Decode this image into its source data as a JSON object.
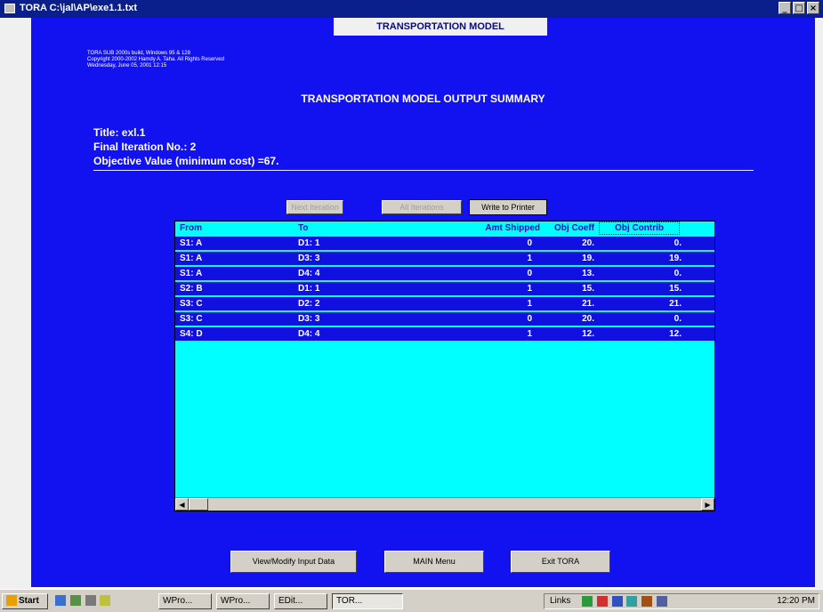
{
  "window": {
    "title": "TORA C:\\jal\\AP\\exe1.1.txt",
    "minimize_glyph": "_",
    "maximize_glyph": "□",
    "close_glyph": "×"
  },
  "panel": {
    "header": "TRANSPORTATION MODEL",
    "copyright": [
      "TORA SUB 2000s build, Windows 95 & 128",
      "Copyright 2000-2002 Hamdy A. Taha. All Rights Reserved",
      "Wednesday, June 05, 2001 12:15"
    ],
    "summary_title": "TRANSPORTATION MODEL OUTPUT SUMMARY",
    "title_line": "Title: exl.1",
    "iteration_line": "Final Iteration No.: 2",
    "objective_line": "Objective Value (minimum cost) =67."
  },
  "actions": {
    "next_iteration": "Next Iteration",
    "all_iterations": "All Iterations",
    "write_to_printer": "Write to Printer"
  },
  "table": {
    "columns": [
      "From",
      "To",
      "Amt Shipped",
      "Obj Coeff",
      "Obj Contrib"
    ],
    "rows": [
      [
        "S1: A",
        "D1: 1",
        "0",
        "20.",
        "0."
      ],
      [
        "S1: A",
        "D3: 3",
        "1",
        "19.",
        "19."
      ],
      [
        "S1: A",
        "D4: 4",
        "0",
        "13.",
        "0."
      ],
      [
        "S2: B",
        "D1: 1",
        "1",
        "15.",
        "15."
      ],
      [
        "S3: C",
        "D2: 2",
        "1",
        "21.",
        "21."
      ],
      [
        "S3: C",
        "D3: 3",
        "0",
        "20.",
        "0."
      ],
      [
        "S4: D",
        "D4: 4",
        "1",
        "12.",
        "12."
      ]
    ]
  },
  "footer_buttons": {
    "view_modify": "View/Modify Input Data",
    "main_menu": "MAIN Menu",
    "exit": "Exit TORA"
  },
  "taskbar": {
    "start": "Start",
    "items": [
      "WPro...",
      "WPro...",
      "EDit...",
      "TOR..."
    ],
    "links": "Links",
    "time": "12:20 PM"
  },
  "colors": {
    "panel_bg": "#1212f0",
    "grid_bg": "#00ffff",
    "header_text": "#1313c8"
  }
}
